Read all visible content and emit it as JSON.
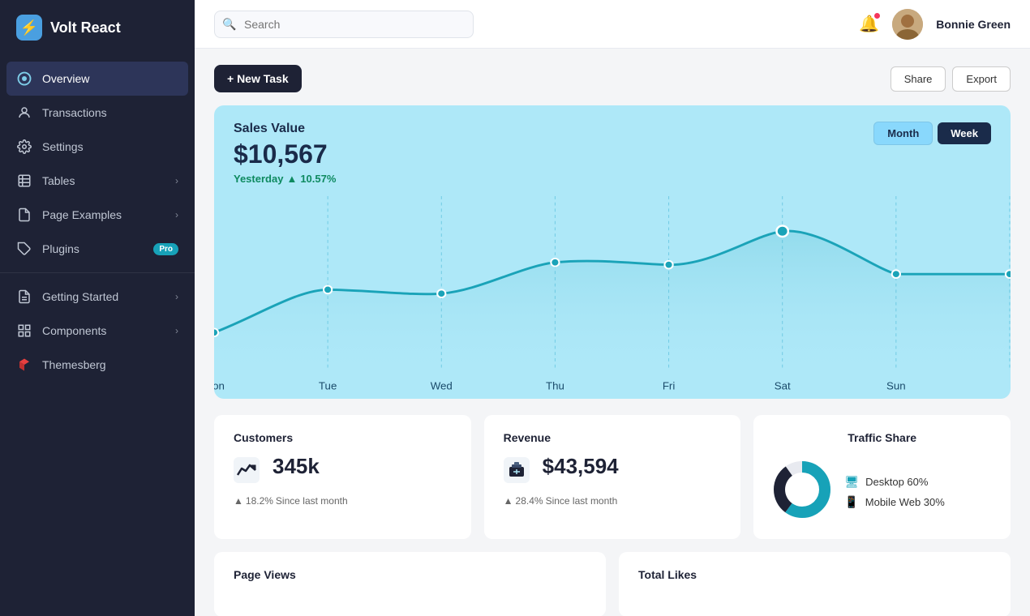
{
  "app": {
    "name": "Volt React",
    "logo_icon": "⚡"
  },
  "sidebar": {
    "items": [
      {
        "id": "overview",
        "label": "Overview",
        "icon": "circle",
        "active": true,
        "chevron": false,
        "badge": null
      },
      {
        "id": "transactions",
        "label": "Transactions",
        "icon": "person",
        "active": false,
        "chevron": false,
        "badge": null
      },
      {
        "id": "settings",
        "label": "Settings",
        "icon": "gear",
        "active": false,
        "chevron": false,
        "badge": null
      },
      {
        "id": "tables",
        "label": "Tables",
        "icon": "table",
        "active": false,
        "chevron": true,
        "badge": null
      },
      {
        "id": "page-examples",
        "label": "Page Examples",
        "icon": "file",
        "active": false,
        "chevron": true,
        "badge": null
      },
      {
        "id": "plugins",
        "label": "Plugins",
        "icon": "plugin",
        "active": false,
        "chevron": false,
        "badge": "Pro"
      },
      {
        "id": "getting-started",
        "label": "Getting Started",
        "icon": "doc",
        "active": false,
        "chevron": true,
        "badge": null
      },
      {
        "id": "components",
        "label": "Components",
        "icon": "components",
        "active": false,
        "chevron": true,
        "badge": null
      },
      {
        "id": "themesberg",
        "label": "Themesberg",
        "icon": "themesberg",
        "active": false,
        "chevron": false,
        "badge": null
      }
    ]
  },
  "header": {
    "search_placeholder": "Search",
    "user_name": "Bonnie Green"
  },
  "toolbar": {
    "new_task_label": "+ New Task",
    "share_label": "Share",
    "export_label": "Export"
  },
  "sales_chart": {
    "title": "Sales Value",
    "value": "$10,567",
    "period_label": "Yesterday",
    "change": "10.57%",
    "period_month": "Month",
    "period_week": "Week",
    "days": [
      "Mon",
      "Tue",
      "Wed",
      "Thu",
      "Fri",
      "Sat",
      "Sun"
    ],
    "data_points": [
      30,
      42,
      40,
      55,
      54,
      70,
      50
    ]
  },
  "stats": [
    {
      "id": "customers",
      "label": "Customers",
      "value": "345k",
      "change": "18.2%",
      "change_text": "Since last month",
      "icon": "chart-up"
    },
    {
      "id": "revenue",
      "label": "Revenue",
      "value": "$43,594",
      "change": "28.4%",
      "change_text": "Since last month",
      "icon": "register"
    }
  ],
  "traffic": {
    "title": "Traffic Share",
    "segments": [
      {
        "label": "Desktop",
        "percent": 60,
        "color": "#17a2b8"
      },
      {
        "label": "Mobile Web",
        "percent": 30,
        "color": "#1e2235"
      }
    ]
  },
  "bottom_cards": [
    {
      "id": "card1",
      "title": "Page Views"
    },
    {
      "id": "card2",
      "title": "Total Likes"
    }
  ],
  "colors": {
    "sidebar_bg": "#1e2235",
    "accent": "#4a9fe0",
    "chart_bg": "#aee8f8",
    "chart_line": "#1aa3b8",
    "positive": "#0e8a60"
  }
}
